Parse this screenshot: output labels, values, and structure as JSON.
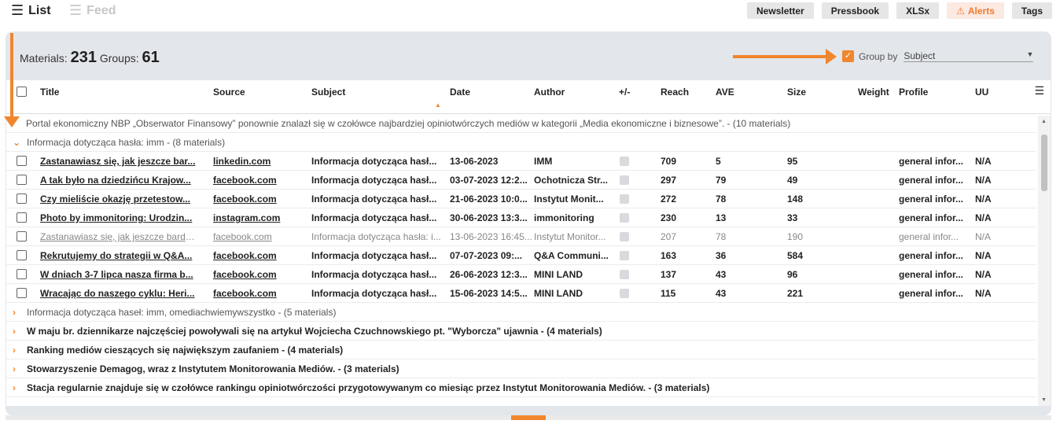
{
  "views": {
    "list": "List",
    "feed": "Feed"
  },
  "toolbar": {
    "newsletter": "Newsletter",
    "pressbook": "Pressbook",
    "xlsx": "XLSx",
    "alerts": "Alerts",
    "tags": "Tags"
  },
  "summary": {
    "materials_label": "Materials:",
    "materials": "231",
    "groups_label": "Groups:",
    "groups": "61"
  },
  "groupby": {
    "label": "Group by",
    "value": "Subject"
  },
  "columns": [
    "Title",
    "Source",
    "Subject",
    "Date",
    "Author",
    "+/-",
    "Reach",
    "AVE",
    "Size",
    "Weight",
    "Profile",
    "UU"
  ],
  "groups_top": [
    "Portal ekonomiczny NBP „Obserwator Finansowy” ponownie znalazł się w czołówce najbardziej opiniotwórczych mediów w kategorii „Media ekonomiczne i biznesowe”. - (10 materials)",
    "Informacja dotycząca hasła: imm - (8 materials)"
  ],
  "rows": [
    {
      "title": "Zastanawiasz się, jak jeszcze bar...",
      "source": "linkedin.com",
      "subject": "Informacja dotycząca hasł...",
      "date": "13-06-2023",
      "author": "IMM",
      "reach": "709",
      "ave": "5",
      "size": "95",
      "profile": "general infor...",
      "uu": "N/A"
    },
    {
      "title": "A tak było na dziedzińcu Krajow...",
      "source": "facebook.com",
      "subject": "Informacja dotycząca hasł...",
      "date": "03-07-2023 12:2...",
      "author": "Ochotnicza Str...",
      "reach": "297",
      "ave": "79",
      "size": "49",
      "profile": "general infor...",
      "uu": "N/A"
    },
    {
      "title": "Czy mieliście okazję przetestow...",
      "source": "facebook.com",
      "subject": "Informacja dotycząca hasł...",
      "date": "21-06-2023 10:0...",
      "author": "Instytut Monit...",
      "reach": "272",
      "ave": "78",
      "size": "148",
      "profile": "general infor...",
      "uu": "N/A"
    },
    {
      "title": "Photo by immonitoring: Urodzin...",
      "source": "instagram.com",
      "subject": "Informacja dotycząca hasł...",
      "date": "30-06-2023 13:3...",
      "author": "immonitoring",
      "reach": "230",
      "ave": "13",
      "size": "33",
      "profile": "general infor...",
      "uu": "N/A"
    },
    {
      "title": "Zastanawiasz się, jak jeszcze bardz...",
      "source": "facebook.com",
      "subject": "Informacja dotycząca hasła: i...",
      "date": "13-06-2023 16:45...",
      "author": "Instytut Monitor...",
      "reach": "207",
      "ave": "78",
      "size": "190",
      "profile": "general infor...",
      "uu": "N/A"
    },
    {
      "title": "Rekrutujemy do strategii w Q&A...",
      "source": "facebook.com",
      "subject": "Informacja dotycząca hasł...",
      "date": "07-07-2023 09:...",
      "author": "Q&A Communi...",
      "reach": "163",
      "ave": "36",
      "size": "584",
      "profile": "general infor...",
      "uu": "N/A"
    },
    {
      "title": "W dniach 3-7 lipca nasza firma b...",
      "source": "facebook.com",
      "subject": "Informacja dotycząca hasł...",
      "date": "26-06-2023 12:3...",
      "author": "MINI LAND",
      "reach": "137",
      "ave": "43",
      "size": "96",
      "profile": "general infor...",
      "uu": "N/A"
    },
    {
      "title": "Wracając do naszego cyklu: Heri...",
      "source": "facebook.com",
      "subject": "Informacja dotycząca hasł...",
      "date": "15-06-2023 14:5...",
      "author": "MINI LAND",
      "reach": "115",
      "ave": "43",
      "size": "221",
      "profile": "general infor...",
      "uu": "N/A"
    }
  ],
  "groups_bottom": [
    "Informacja dotycząca haseł: imm, omediachwiemywszystko - (5 materials)",
    "W maju br. dziennikarze najczęściej powoływali się na artykuł Wojciecha Czuchnowskiego pt. \"Wyborcza\" ujawnia - (4 materials)",
    "Ranking mediów cieszących się największym zaufaniem - (4 materials)",
    "Stowarzyszenie Demagog, wraz z Instytutem Monitorowania Mediów. - (3 materials)",
    "Stacja regularnie znajduje się w czołówce rankingu opiniotwórczości przygotowywanym co miesiąc przez Instytut Monitorowania Mediów. - (3 materials)"
  ]
}
